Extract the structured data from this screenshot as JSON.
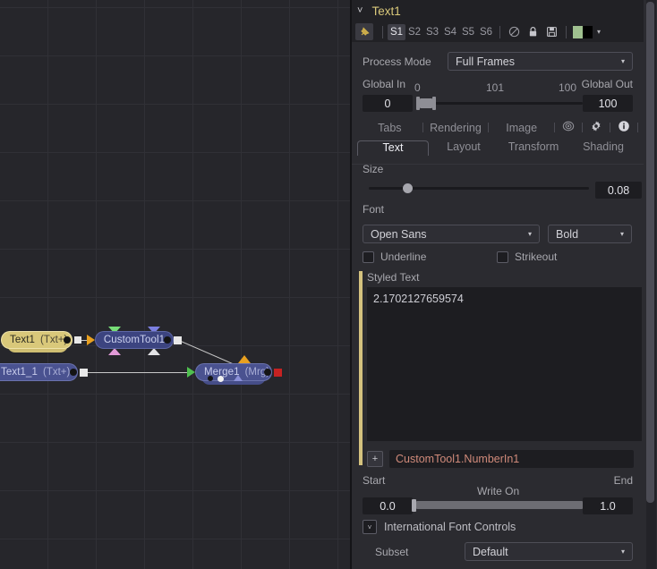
{
  "flow": {
    "nodes": [
      {
        "id": "text1",
        "name": "Text1",
        "type": "(Txt+)"
      },
      {
        "id": "customtool1",
        "name": "CustomTool1",
        "type": ""
      },
      {
        "id": "text1_1",
        "name": "Text1_1",
        "type": "(Txt+)"
      },
      {
        "id": "merge1",
        "name": "Merge1",
        "type": "(Mrg)"
      }
    ]
  },
  "inspector": {
    "header": {
      "chevron": "˅",
      "title": "Text1"
    },
    "toolbar": {
      "pin_icon": "pin-icon",
      "state_tabs": [
        "S1",
        "S2",
        "S3",
        "S4",
        "S5",
        "S6"
      ],
      "active_state": "S1",
      "disable_icon": "⊘",
      "lock_icon": "lock-icon",
      "save_icon": "save-icon",
      "swatch_left": "#9fc08f",
      "swatch_right": "#000000",
      "caret": "▾"
    },
    "process_mode": {
      "label": "Process Mode",
      "value": "Full Frames",
      "caret": "▾"
    },
    "global_range": {
      "in_label": "Global In",
      "out_label": "Global Out",
      "in_value": "0",
      "out_value": "100",
      "tick_start": "0",
      "tick_mid": "101",
      "tick_end": "100"
    },
    "tabs_row1": [
      "Tabs",
      "Rendering",
      "Image"
    ],
    "tabs_row1_icons": [
      "target-icon",
      "gear-icon",
      "info-icon"
    ],
    "tabs_row2": [
      "Text",
      "Layout",
      "Transform",
      "Shading"
    ],
    "active_tab": "Text",
    "size": {
      "label": "Size",
      "value": "0.08"
    },
    "font": {
      "label": "Font",
      "family": "Open Sans",
      "style": "Bold",
      "caret": "▾"
    },
    "underline": {
      "label": "Underline",
      "checked": false
    },
    "strikeout": {
      "label": "Strikeout",
      "checked": false
    },
    "styled_text": {
      "label": "Styled Text",
      "value": "2.1702127659574"
    },
    "expression": {
      "plus": "+",
      "value": "CustomTool1.NumberIn1"
    },
    "write_on": {
      "start_label": "Start",
      "end_label": "End",
      "title": "Write On",
      "start_value": "0.0",
      "end_value": "1.0"
    },
    "international": {
      "label": "International Font Controls",
      "caret": "˅"
    },
    "subset": {
      "label": "Subset",
      "value": "Default",
      "caret": "▾"
    }
  }
}
